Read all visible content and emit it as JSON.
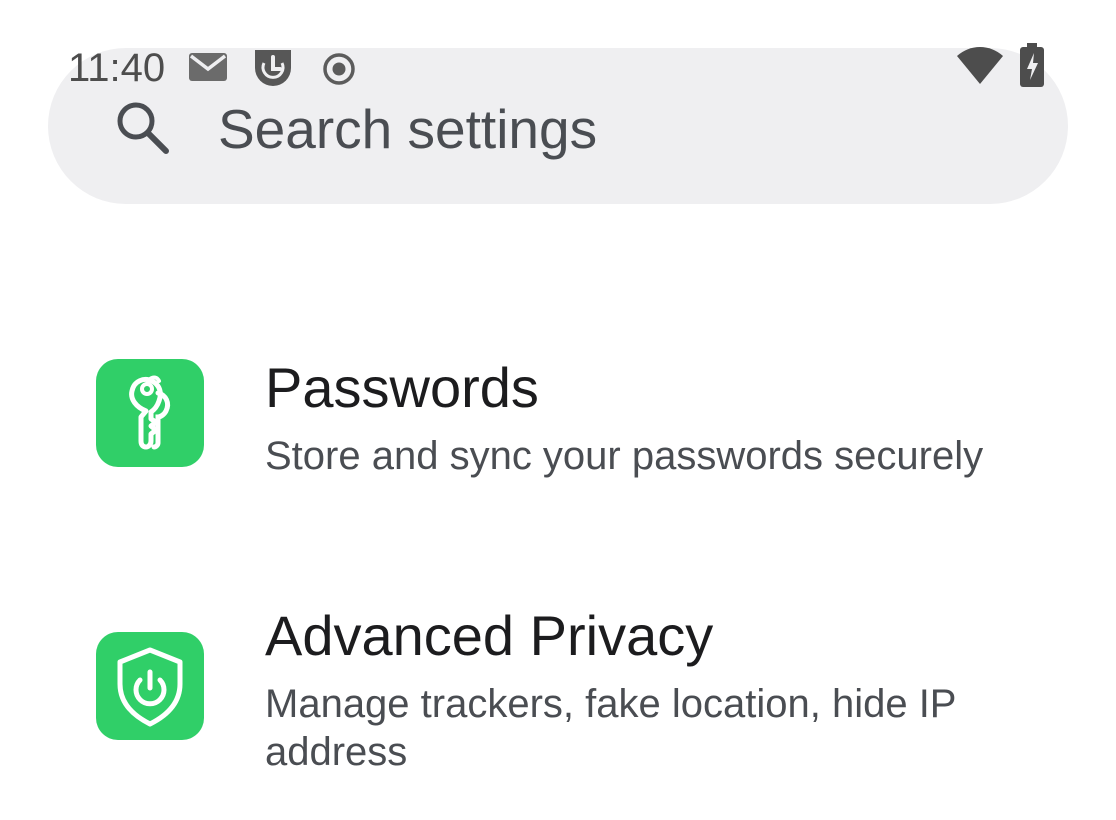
{
  "status_bar": {
    "time": "11:40",
    "icons": [
      "mail-icon",
      "app-notification-icon",
      "recording-icon",
      "wifi-icon",
      "battery-charging-icon"
    ]
  },
  "search": {
    "placeholder": "Search settings",
    "icon": "search-icon"
  },
  "settings": {
    "items": [
      {
        "title": "Passwords",
        "summary": "Store and sync your passwords securely",
        "icon": "key-icon",
        "icon_color": "#30cf68"
      },
      {
        "title": "Advanced Privacy",
        "summary": "Manage trackers, fake location, hide IP address",
        "icon": "shield-power-icon",
        "icon_color": "#30cf68"
      }
    ]
  }
}
